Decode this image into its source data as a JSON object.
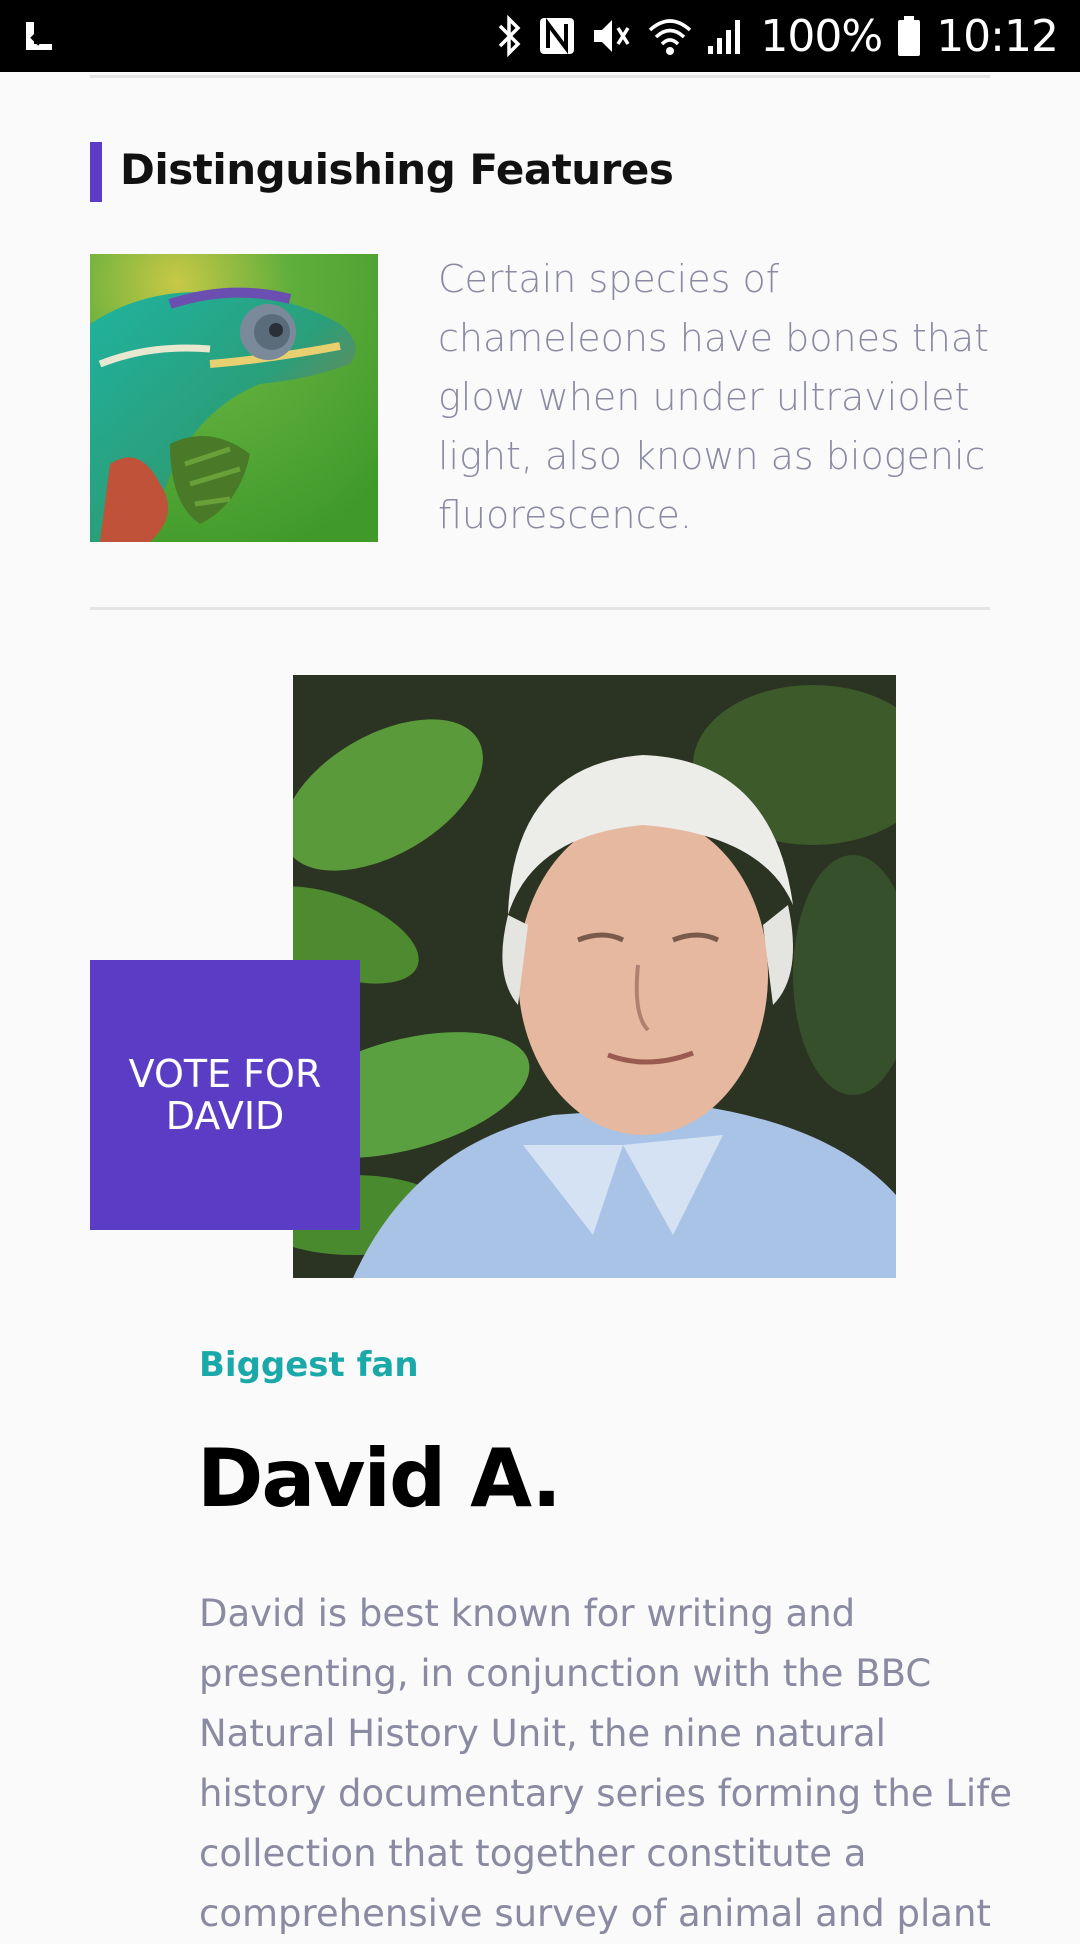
{
  "status_bar": {
    "battery": "100%",
    "time": "10:12",
    "icons": [
      "app-notification-icon",
      "bluetooth-icon",
      "nfc-icon",
      "mute-icon",
      "wifi-icon",
      "signal-icon",
      "battery-icon"
    ]
  },
  "features": {
    "title": "Distinguishing Features",
    "image_alt": "chameleon",
    "text": "Certain species of chameleons have bones that glow when under ultraviolet light, also known as biogenic fluorescence."
  },
  "fan": {
    "vote_label": "VOTE FOR DAVID",
    "label": "Biggest fan",
    "name": "David A.",
    "bio": "David is best known for writing and presenting, in conjunction with the BBC Natural History Unit, the nine natural history documentary series forming the Life collection that together constitute a comprehensive survey of animal and plant"
  },
  "colors": {
    "accent": "#5b3cc4",
    "teal": "#1aa8a8",
    "body_text": "#8a8aa3"
  }
}
